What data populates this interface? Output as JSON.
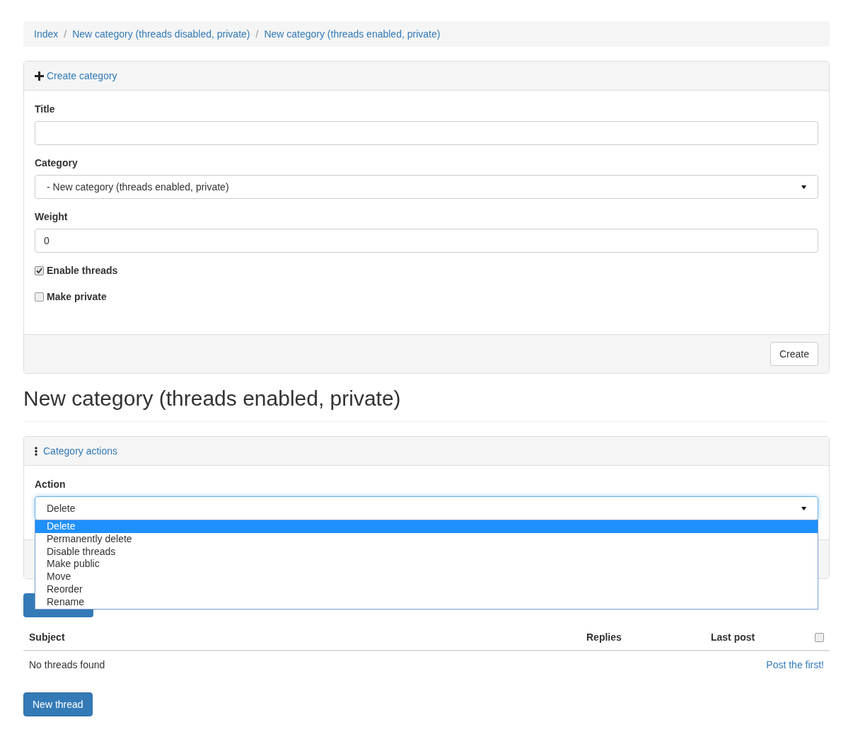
{
  "breadcrumb": [
    {
      "label": "Index"
    },
    {
      "separator": "/",
      "label": "New category (threads disabled, private)"
    },
    {
      "separator": "/",
      "label": "New category (threads enabled, private)"
    }
  ],
  "create_panel": {
    "title": "Create category",
    "fields": [
      {
        "kind": "text",
        "label": "Title"
      },
      {
        "kind": "select",
        "label": "Category",
        "value": "- New category (threads enabled, private)"
      },
      {
        "kind": "text",
        "label": "Weight",
        "value": "0"
      }
    ],
    "checkboxes": [
      {
        "label": "Enable threads",
        "checked": true
      },
      {
        "label": "Make private",
        "checked": false
      }
    ],
    "button": "Create"
  },
  "heading": "New category (threads enabled, private)",
  "actions_panel": {
    "title": "Category actions",
    "label": "Action",
    "value": "Delete",
    "options": [
      {
        "label": "Delete",
        "selected": true
      },
      {
        "label": "Permanently delete",
        "selected": false
      },
      {
        "label": "Disable threads",
        "selected": false
      },
      {
        "label": "Make public",
        "selected": false
      },
      {
        "label": "Move",
        "selected": false
      },
      {
        "label": "Reorder",
        "selected": false
      },
      {
        "label": "Rename",
        "selected": false
      }
    ]
  },
  "table": {
    "columns": [
      "Subject",
      "Replies",
      "Last post"
    ],
    "select_all_checked": false,
    "empty": "No threads found",
    "link": "Post the first!"
  },
  "new_thread_button": "New thread"
}
